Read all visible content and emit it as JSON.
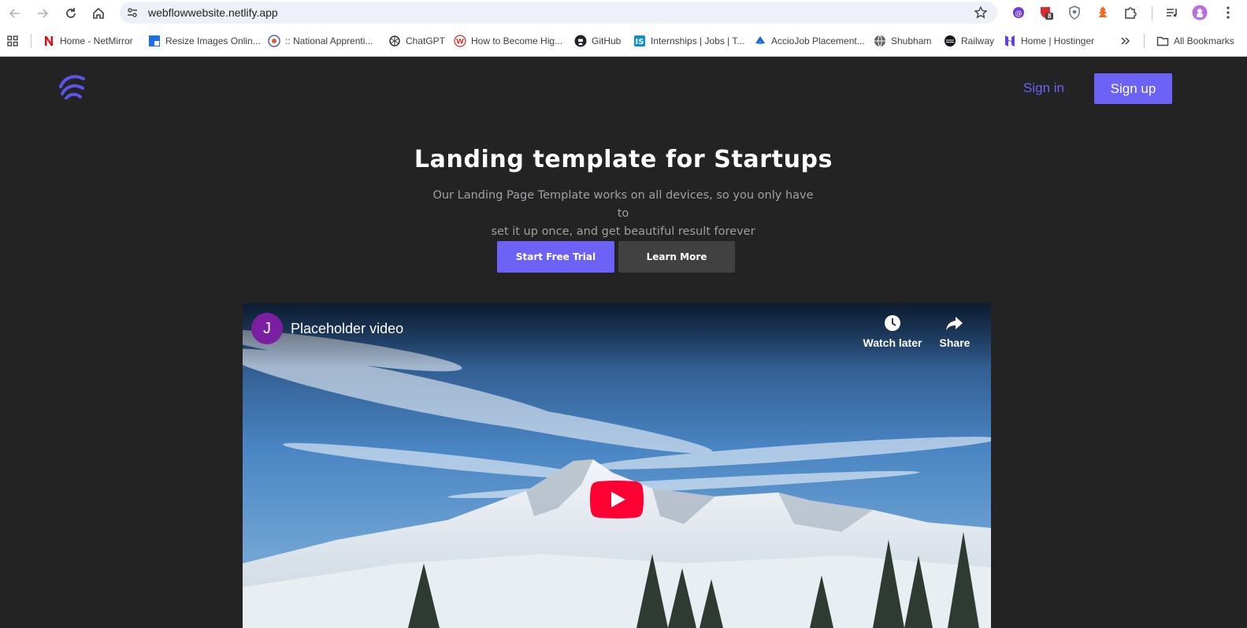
{
  "browser": {
    "url": "webflowwebsite.netlify.app",
    "bookmarks": [
      {
        "label": "Home - NetMirror",
        "icon": "netmirror-icon"
      },
      {
        "label": "Resize Images Onlin...",
        "icon": "resize-icon"
      },
      {
        "label": ":: National Apprenti...",
        "icon": "apprentice-icon"
      },
      {
        "label": "ChatGPT",
        "icon": "chatgpt-icon"
      },
      {
        "label": "How to Become Hig...",
        "icon": "w-icon"
      },
      {
        "label": "GitHub",
        "icon": "github-icon"
      },
      {
        "label": "Internships | Jobs | T...",
        "icon": "internshala-icon"
      },
      {
        "label": "AccioJob Placement...",
        "icon": "acciojob-icon"
      },
      {
        "label": "Shubham",
        "icon": "globe-icon"
      },
      {
        "label": "Railway",
        "icon": "railway-icon"
      },
      {
        "label": "Home | Hostinger",
        "icon": "hostinger-icon"
      }
    ],
    "all_bookmarks": "All Bookmarks",
    "extension_badge": "8"
  },
  "page": {
    "nav": {
      "sign_in": "Sign in",
      "sign_up": "Sign up"
    },
    "hero": {
      "title": "Landing template for Startups",
      "subtitle_line1": "Our Landing Page Template works on all devices, so you only have to",
      "subtitle_line2": "set it up once, and get beautiful result forever",
      "primary_cta": "Start Free Trial",
      "secondary_cta": "Learn More"
    },
    "video": {
      "channel_initial": "J",
      "title": "Placeholder video",
      "watch_later": "Watch later",
      "share": "Share"
    },
    "colors": {
      "accent": "#6c63f6",
      "background": "#232323",
      "youtube_red": "#ff0033"
    }
  }
}
